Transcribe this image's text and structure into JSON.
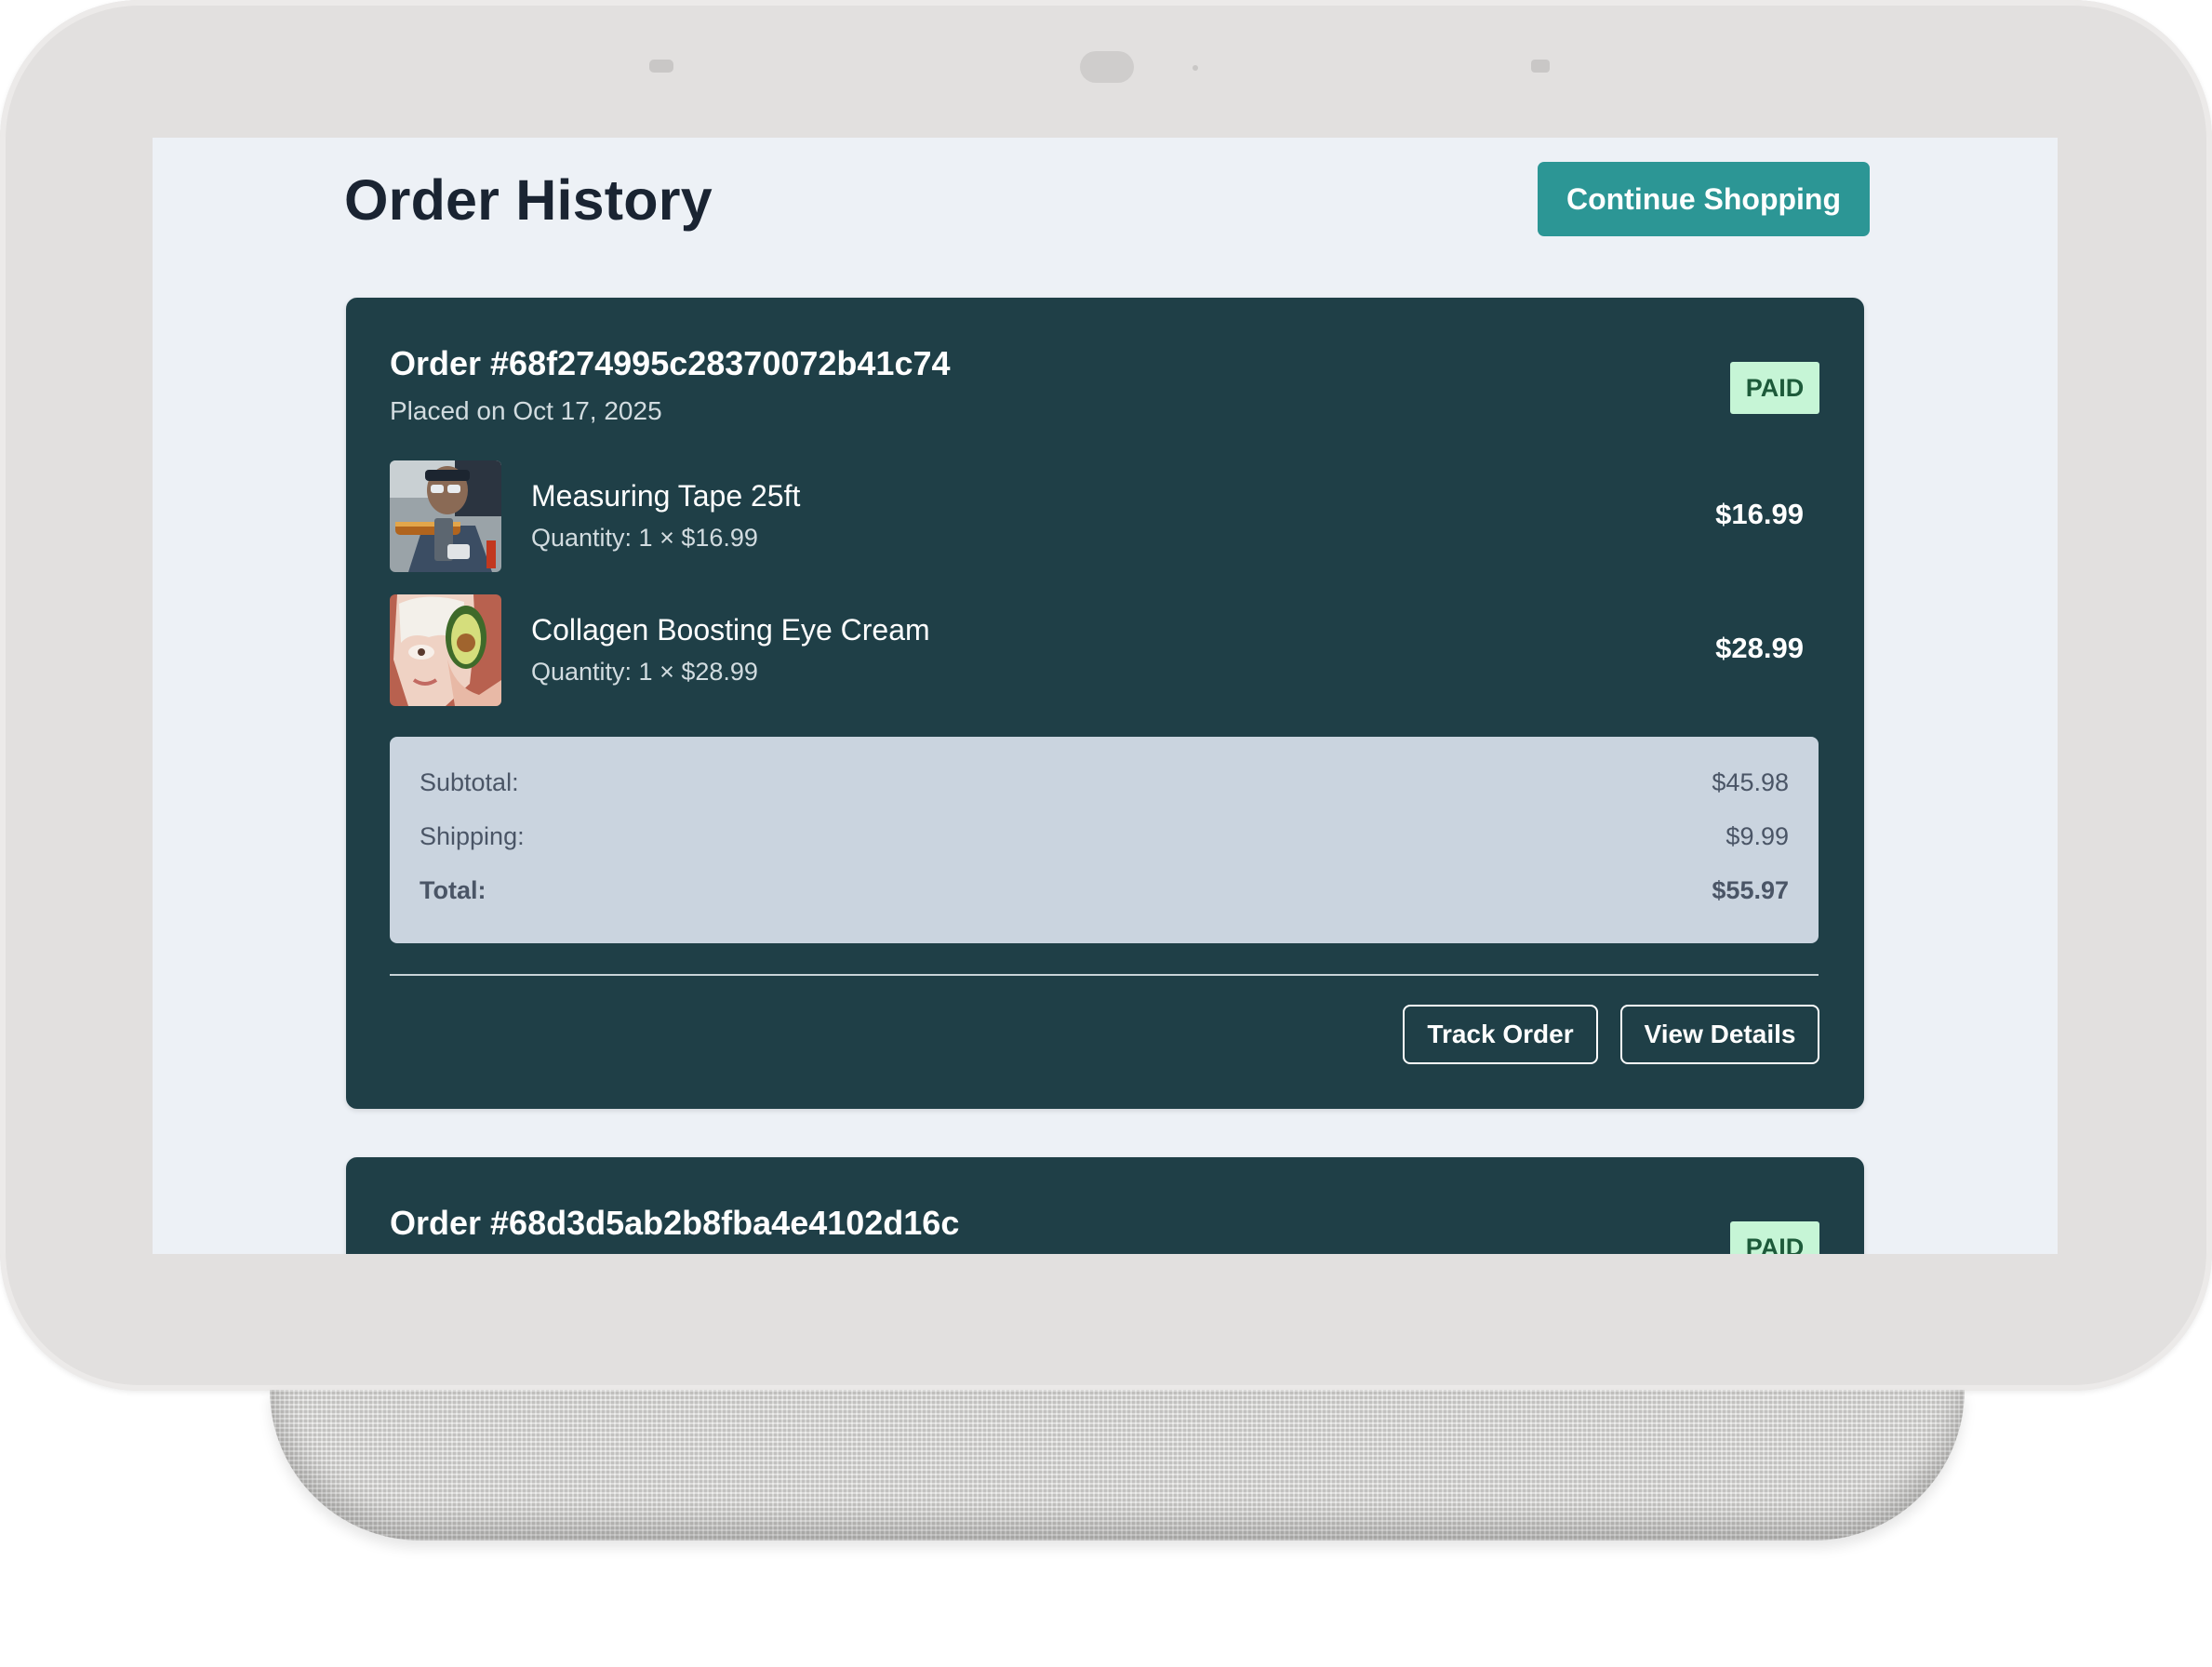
{
  "page": {
    "title": "Order History",
    "continue_label": "Continue Shopping"
  },
  "orders": [
    {
      "number": "Order #68f274995c28370072b41c74",
      "date": "Placed on Oct 17, 2025",
      "status": "PAID",
      "items": [
        {
          "name": "Measuring Tape 25ft",
          "quantity": "Quantity: 1 × $16.99",
          "price": "$16.99",
          "thumb_icon": "measuring-tape-photo"
        },
        {
          "name": "Collagen Boosting Eye Cream",
          "quantity": "Quantity: 1 × $28.99",
          "price": "$28.99",
          "thumb_icon": "eye-cream-photo"
        }
      ],
      "summary": {
        "subtotal_label": "Subtotal:",
        "subtotal": "$45.98",
        "shipping_label": "Shipping:",
        "shipping": "$9.99",
        "total_label": "Total:",
        "total": "$55.97"
      },
      "actions": {
        "track_label": "Track Order",
        "details_label": "View Details"
      }
    },
    {
      "number": "Order #68d3d5ab2b8fba4e4102d16c",
      "status": "PAID"
    }
  ],
  "colors": {
    "card_bg": "#1f3f47",
    "accent": "#2c9695",
    "badge_bg": "#c6f5d6",
    "badge_text": "#1d5a3a",
    "summary_bg": "#cad4df",
    "screen_bg": "#edf1f6"
  }
}
